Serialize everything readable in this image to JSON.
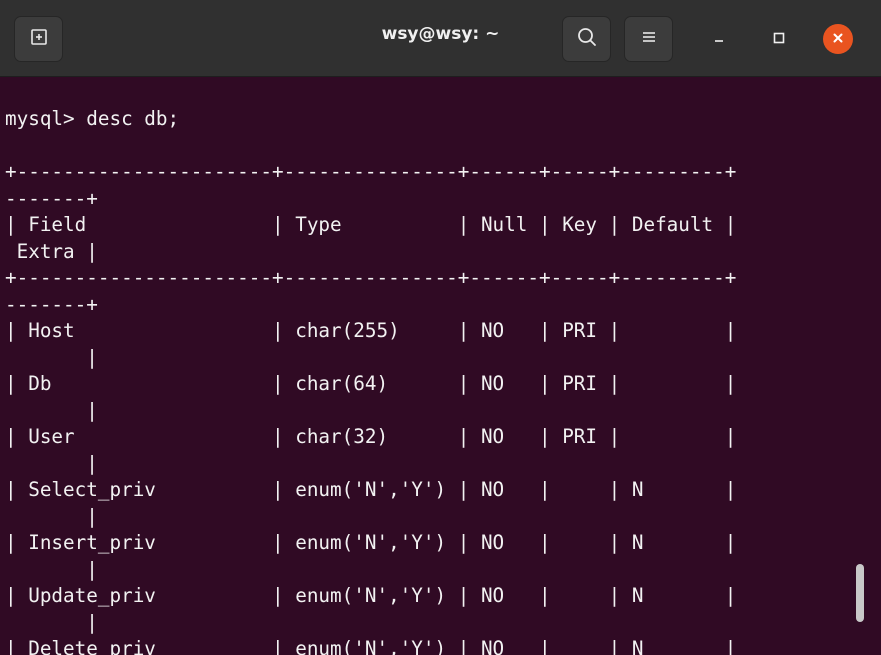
{
  "window": {
    "title": "wsy@wsy: ~"
  },
  "header": {
    "new_tab_icon": "new-tab-icon",
    "search_icon": "search-icon",
    "menu_icon": "hamburger-menu-icon",
    "minimize_icon": "minimize-icon",
    "maximize_icon": "maximize-icon",
    "close_icon": "close-icon",
    "close_color": "#e95420"
  },
  "terminal": {
    "background": "#300a24",
    "command_line": "mysql> desc db;",
    "lines": [
      "+----------------------+---------------+------+-----+---------+",
      "-------+",
      "| Field                | Type          | Null | Key | Default |",
      " Extra |",
      "+----------------------+---------------+------+-----+---------+",
      "-------+",
      "| Host                 | char(255)     | NO   | PRI |         |",
      "       |",
      "| Db                   | char(64)      | NO   | PRI |         |",
      "       |",
      "| User                 | char(32)      | NO   | PRI |         |",
      "       |",
      "| Select_priv          | enum('N','Y') | NO   |     | N       |",
      "       |",
      "| Insert_priv          | enum('N','Y') | NO   |     | N       |",
      "       |",
      "| Update_priv          | enum('N','Y') | NO   |     | N       |",
      "       |",
      "| Delete_priv          | enum('N','Y') | NO   |     | N       |"
    ]
  }
}
